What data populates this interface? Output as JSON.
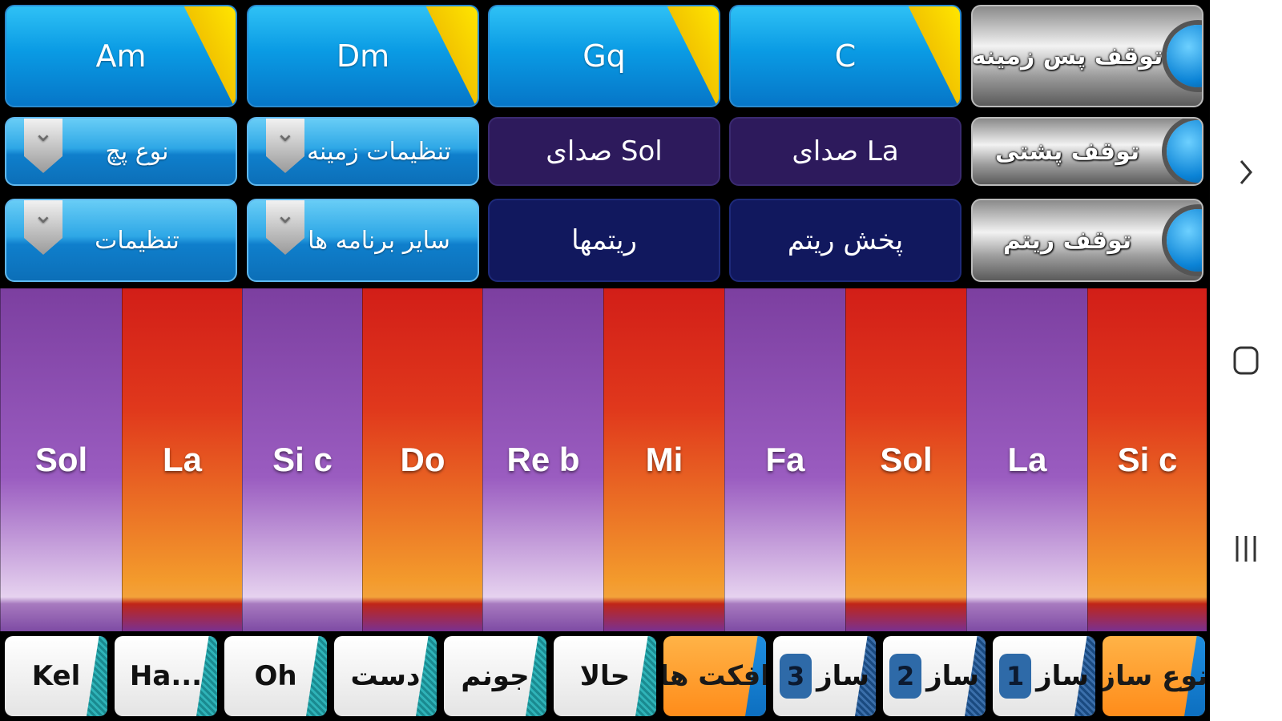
{
  "chords": [
    {
      "label": "Am"
    },
    {
      "label": "Dm"
    },
    {
      "label": "Gq"
    },
    {
      "label": "C"
    }
  ],
  "stop_buttons": {
    "background": "توقف پس زمینه",
    "backing": "توقف پشتی",
    "rhythm": "توقف ریتم"
  },
  "row2": {
    "patch_type": "نوع پچ",
    "background_settings": "تنظیمات زمینه",
    "sol_sound": "صدای Sol",
    "la_sound": "صدای La"
  },
  "row3": {
    "settings": "تنظیمات",
    "other_apps": "سایر برنامه ها",
    "rhythms": "ریتمها",
    "play_rhythm": "پخش ریتم"
  },
  "keys": [
    "Sol",
    "La",
    "Si c",
    "Do",
    "Re b",
    "Mi",
    "Fa",
    "Sol",
    "La",
    "Si c"
  ],
  "bottom_tabs": {
    "kel": "Kel",
    "ha": "Ha...",
    "oh": "Oh",
    "dast": "دست",
    "joonam": "جونم",
    "hala": "حالا",
    "effects": "افکت ها",
    "saz3_label": "ساز",
    "saz3_num": "3",
    "saz2_label": "ساز",
    "saz2_num": "2",
    "saz1_label": "ساز",
    "saz1_num": "1",
    "instrument_type": "نوع ساز"
  },
  "nav_icons": [
    "chevron-right-icon",
    "home-square-icon",
    "recent-apps-icon"
  ],
  "colors": {
    "chord_blue": "#0a9be4",
    "chord_corner": "#f2c400",
    "key_purple": "#9a5cc0",
    "key_red": "#e0381c",
    "row_purple": "#2d1a5c",
    "row_navy": "#11185e",
    "tab_orange": "#ff8c1a"
  }
}
